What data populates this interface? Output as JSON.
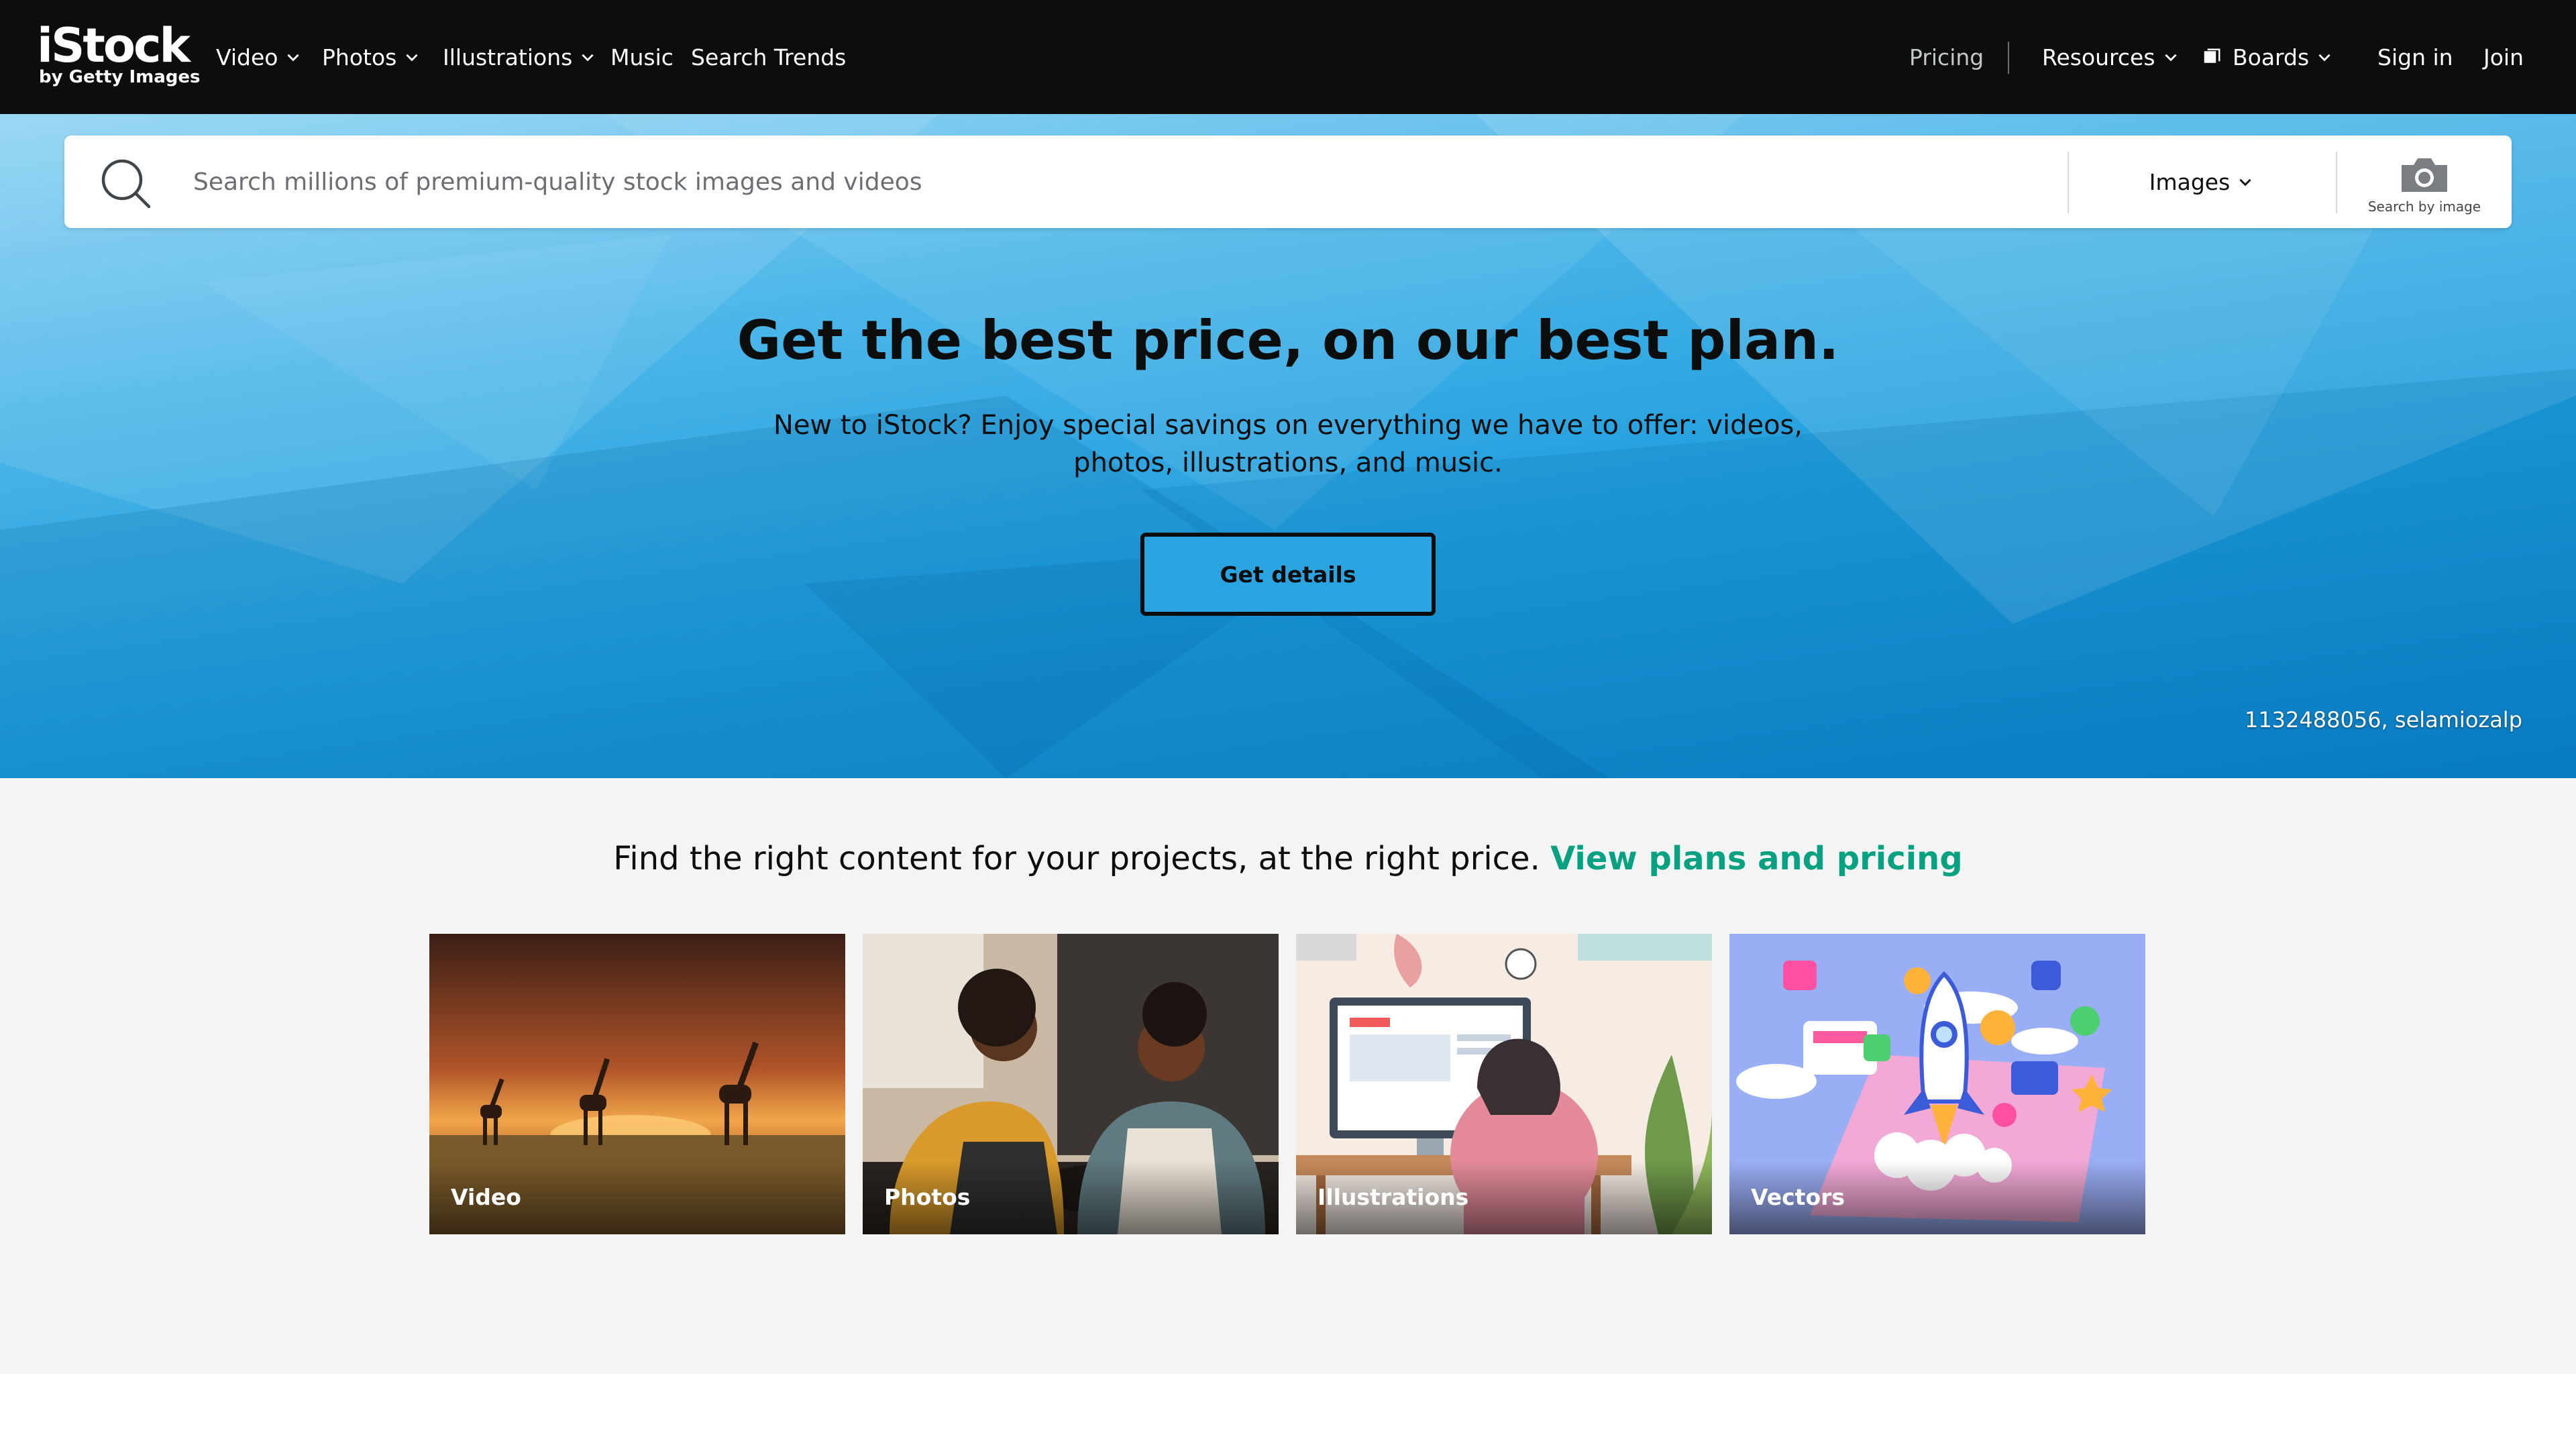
{
  "nav": {
    "logo": {
      "wordmark": "iStock",
      "tagline": "by Getty Images"
    },
    "left_items": [
      {
        "label": "Video",
        "dropdown": true
      },
      {
        "label": "Photos",
        "dropdown": true
      },
      {
        "label": "Illustrations",
        "dropdown": true
      },
      {
        "label": "Music",
        "dropdown": false
      },
      {
        "label": "Search Trends",
        "dropdown": false
      }
    ],
    "pricing": "Pricing",
    "resources": "Resources",
    "boards": "Boards",
    "sign_in": "Sign in",
    "join": "Join"
  },
  "search": {
    "placeholder": "Search millions of premium-quality stock images and videos",
    "value": "",
    "type_selected": "Images",
    "image_search_label": "Search by image"
  },
  "hero": {
    "title": "Get the best price, on our best plan.",
    "subtitle": "New to iStock? Enjoy special savings on everything we have to offer: videos, photos, illustrations, and music.",
    "cta": "Get details",
    "credit": "1132488056, selamiozalp"
  },
  "content": {
    "tagline_text": "Find the right content for your projects, at the right price.",
    "tagline_link": "View plans and pricing",
    "tiles": [
      {
        "label": "Video"
      },
      {
        "label": "Photos"
      },
      {
        "label": "Illustrations"
      },
      {
        "label": "Vectors"
      }
    ]
  },
  "colors": {
    "nav_bg": "#0c0d0d",
    "hero_blue": "#1d9ddd",
    "link_green": "#08a181",
    "section_bg": "#f4f4f4"
  },
  "icons": [
    "search-icon",
    "chevron-down-icon",
    "boards-icon",
    "camera-icon"
  ]
}
